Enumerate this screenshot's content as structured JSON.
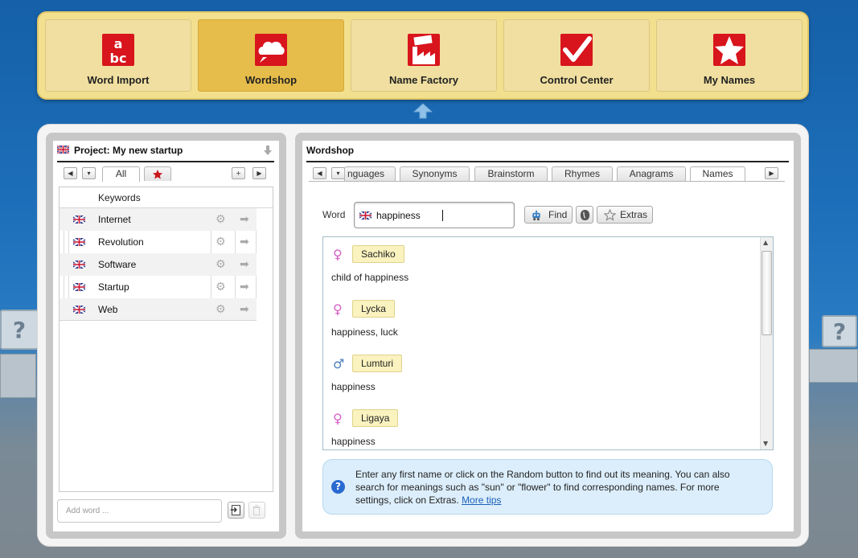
{
  "nav": {
    "items": [
      {
        "label": "Word Import",
        "icon": "abc-icon"
      },
      {
        "label": "Wordshop",
        "icon": "wordshop-icon"
      },
      {
        "label": "Name Factory",
        "icon": "name-factory-icon"
      },
      {
        "label": "Control Center",
        "icon": "checkmark-icon"
      },
      {
        "label": "My Names",
        "icon": "star-icon"
      }
    ],
    "active_index": 1
  },
  "project": {
    "title": "Project: My new startup",
    "tabs": {
      "all": "All",
      "favorites_icon": "star-icon"
    },
    "add_button": "+",
    "table_header": "Keywords",
    "keywords": [
      "Internet",
      "Revolution",
      "Software",
      "Startup",
      "Web"
    ],
    "add_word_placeholder": "Add word ..."
  },
  "wordshop": {
    "title": "Wordshop",
    "tabs": [
      "nguages",
      "Synonyms",
      "Brainstorm",
      "Rhymes",
      "Anagrams",
      "Names"
    ],
    "active_tab": "Names",
    "word_label": "Word",
    "word_value": "happiness",
    "find_label": "Find",
    "extras_label": "Extras",
    "results": [
      {
        "name": "Sachiko",
        "gender": "female",
        "meaning": "child of happiness"
      },
      {
        "name": "Lycka",
        "gender": "female",
        "meaning": "happiness, luck"
      },
      {
        "name": "Lumturi",
        "gender": "male",
        "meaning": "happiness"
      },
      {
        "name": "Ligaya",
        "gender": "female",
        "meaning": "happiness"
      }
    ],
    "tip_text": "Enter any first name or click on the Random button to find out its meaning. You can also search for meanings such as \"sun\" or \"flower\" to find corresponding names. For more settings, click on Extras.",
    "tip_link": "More tips"
  },
  "colors": {
    "nav_bg": "#f3e08f",
    "nav_active": "#e6bd4b",
    "name_chip": "#faf2bf",
    "tip_bg": "#dceefb",
    "female": "#d65fc7",
    "male": "#4a7fbf"
  }
}
